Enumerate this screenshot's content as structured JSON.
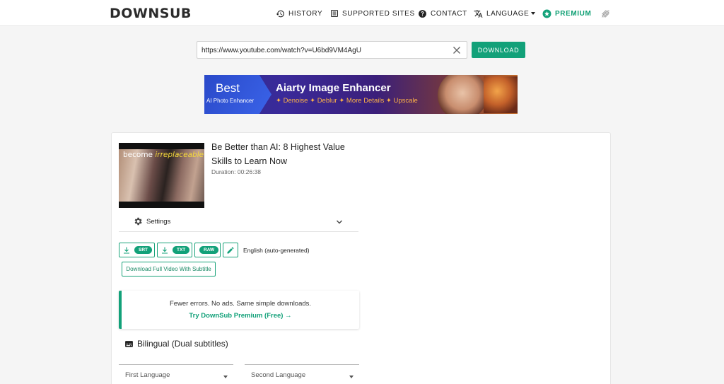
{
  "nav": {
    "logo": "DOWNSUB",
    "items": [
      {
        "label": "HISTORY",
        "icon": "history-icon"
      },
      {
        "label": "SUPPORTED SITES",
        "icon": "list-icon"
      },
      {
        "label": "CONTACT",
        "icon": "help-icon"
      },
      {
        "label": "LANGUAGE",
        "icon": "translate-icon"
      },
      {
        "label": "PREMIUM",
        "icon": "star-icon"
      }
    ],
    "theme_icon": "brightness-icon",
    "accent_color": "#12a179"
  },
  "search": {
    "url_value": "https://www.youtube.com/watch?v=U6bd9VM4AgU",
    "download_label": "DOWNLOAD"
  },
  "banner": {
    "best": "Best",
    "sub": "AI Photo Enhancer",
    "title": "Aiarty Image Enhancer",
    "features": "✦ Denoise ✦ Deblur ✦ More Details ✦ Upscale"
  },
  "video": {
    "thumb_text_1": "become",
    "thumb_text_2": "irreplaceable",
    "title": "Be Better than AI: 8 Highest Value Skills to Learn Now",
    "duration": "Duration: 00:26:38"
  },
  "settings": {
    "label": "Settings"
  },
  "downloads": {
    "srt": "SRT",
    "txt": "TXT",
    "raw": "RAW",
    "language": "English (auto-generated)",
    "full_video": "Download Full Video With Subtitle"
  },
  "promo": {
    "line1": "Fewer errors. No ads. Same simple downloads.",
    "line2": "Try DownSub Premium (Free) →"
  },
  "bilingual": {
    "title": "Bilingual (Dual subtitles)",
    "first_language": "First Language",
    "second_language": "Second Language"
  }
}
